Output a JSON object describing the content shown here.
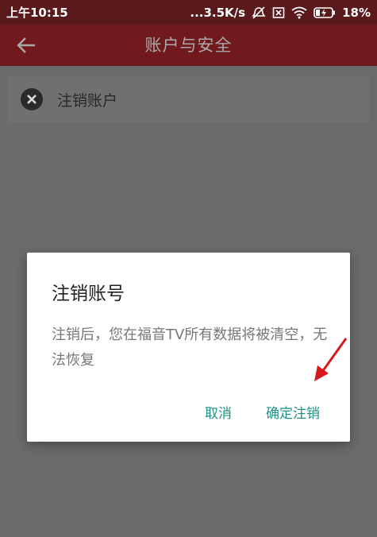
{
  "status_bar": {
    "time": "上午10:15",
    "network_speed": "...3.5K/s",
    "battery": "18%"
  },
  "toolbar": {
    "title": "账户与安全"
  },
  "list": {
    "items": [
      {
        "label": "注销账户",
        "icon": "close-circle-icon"
      }
    ]
  },
  "dialog": {
    "title": "注销账号",
    "message": "注销后，您在福音TV所有数据将被清空，无法恢复",
    "cancel_label": "取消",
    "confirm_label": "确定注销"
  },
  "colors": {
    "toolbar": "#711a1d",
    "accent": "#1f9285",
    "annotation": "#d8161b"
  }
}
